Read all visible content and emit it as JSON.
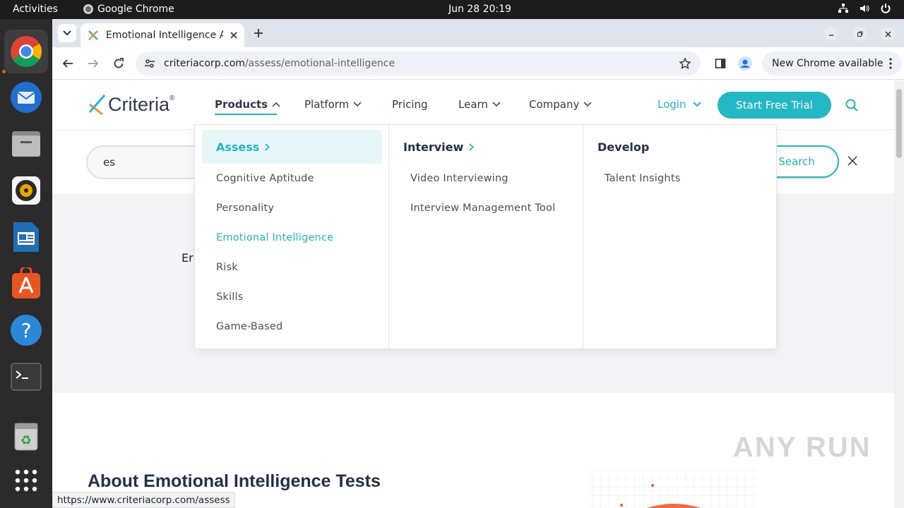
{
  "system": {
    "activities": "Activities",
    "app_name": "Google Chrome",
    "clock": "Jun 28  20:19"
  },
  "dock": {
    "items": [
      "chrome-icon",
      "thunderbird-icon",
      "files-icon",
      "rhythmbox-icon",
      "writer-icon",
      "app-center-icon",
      "help-icon",
      "terminal-icon",
      "trash-icon",
      "app-grid-icon"
    ]
  },
  "browser": {
    "tab_title": "Emotional Intelligence A",
    "url_host": "criteriacorp.com",
    "url_path": "/assess/emotional-intelligence",
    "new_chrome": "New Chrome available",
    "status_url": "https://www.criteriacorp.com/assess"
  },
  "site": {
    "logo": "Criteria",
    "logo_mark": "®",
    "nav": {
      "products": "Products",
      "platform": "Platform",
      "pricing": "Pricing",
      "learn": "Learn",
      "company": "Company",
      "login": "Login",
      "trial": "Start Free Trial"
    },
    "search": {
      "value": "es",
      "button": "Search"
    },
    "hero_text": "Er",
    "about_heading": "About Emotional Intelligence Tests"
  },
  "dropdown": {
    "assess": {
      "heading": "Assess",
      "items": [
        "Cognitive Aptitude",
        "Personality",
        "Emotional Intelligence",
        "Risk",
        "Skills",
        "Game-Based"
      ]
    },
    "interview": {
      "heading": "Interview",
      "items": [
        "Video Interviewing",
        "Interview Management Tool"
      ]
    },
    "develop": {
      "heading": "Develop",
      "items": [
        "Talent Insights"
      ]
    }
  },
  "watermark": "ANY RUN",
  "colors": {
    "accent": "#23b8c4",
    "text_dark": "#22304a"
  }
}
